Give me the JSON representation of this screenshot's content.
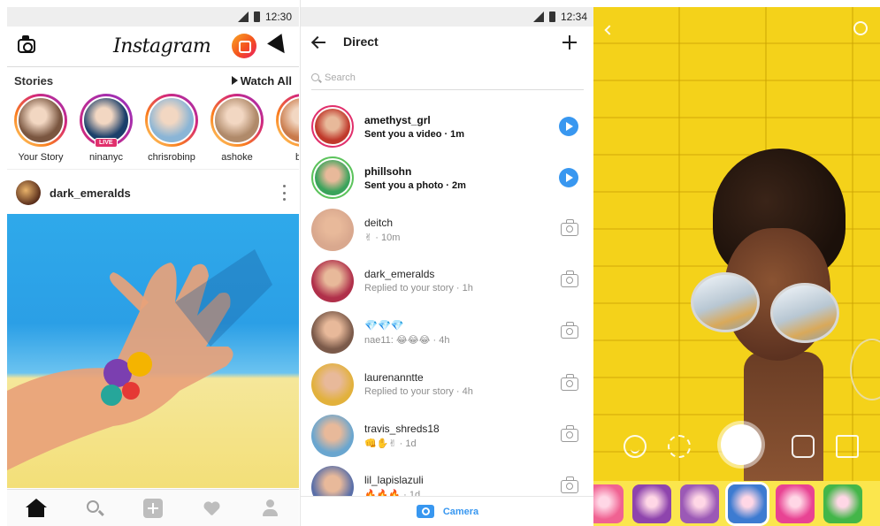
{
  "status_bars": {
    "left_time": "12:30",
    "middle_time": "12:34"
  },
  "feed": {
    "logo": "Instagram",
    "stories_label": "Stories",
    "watch_all_label": "Watch All",
    "stories": [
      {
        "name": "Your Story",
        "live": false,
        "color": "#7a5640"
      },
      {
        "name": "ninanyc",
        "live": true,
        "live_label": "LIVE",
        "color": "#1b3f6a"
      },
      {
        "name": "chrisrobinp",
        "live": false,
        "color": "#8ab5d6"
      },
      {
        "name": "ashoke",
        "live": false,
        "color": "#b08a6a"
      },
      {
        "name": "ber",
        "live": false,
        "color": "#c97a4a"
      }
    ],
    "post": {
      "username": "dark_emeralds"
    },
    "nav": [
      "home-icon",
      "search-icon",
      "add-icon",
      "heart-icon",
      "profile-icon"
    ]
  },
  "direct": {
    "title": "Direct",
    "search_placeholder": "Search",
    "threads": [
      {
        "name": "amethyst_grl",
        "message": "Sent you a video · 1m",
        "unread": true,
        "action": "play",
        "color": "#c0392b"
      },
      {
        "name": "phillsohn",
        "message": "Sent you a photo · 2m",
        "unread": true,
        "action": "play",
        "color": "#3aa35b"
      },
      {
        "name": "deitch",
        "message": "✌ · 10m",
        "unread": false,
        "action": "camera",
        "color": "#d9a88e"
      },
      {
        "name": "dark_emeralds",
        "message": "Replied to your story · 1h",
        "unread": false,
        "action": "camera",
        "color": "#b0304a"
      },
      {
        "name": "💎💎💎",
        "message": "nae11: 😂😂😂 · 4h",
        "unread": false,
        "action": "camera",
        "color": "#7b5a4a"
      },
      {
        "name": "laurenanntte",
        "message": "Replied to your story · 4h",
        "unread": false,
        "action": "camera",
        "color": "#e2b13c"
      },
      {
        "name": "travis_shreds18",
        "message": "👊✋✌ · 1d",
        "unread": false,
        "action": "camera",
        "color": "#6aa6cf"
      },
      {
        "name": "lil_lapislazuli",
        "message": "🔥🔥🔥 · 1d",
        "unread": false,
        "action": "camera",
        "color": "#5a6fa8"
      }
    ],
    "camera_label": "Camera"
  },
  "camera": {
    "filters": [
      {
        "name": "pink-face-filter",
        "color": "#f06292"
      },
      {
        "name": "purple-balloon-filter",
        "color": "#8e44ad"
      },
      {
        "name": "puppy-filter",
        "color": "#9b59b6"
      },
      {
        "name": "sunglasses-filter",
        "color": "#3d7bd1"
      },
      {
        "name": "sparkle-filter",
        "color": "#e84393"
      },
      {
        "name": "lips-filter",
        "color": "#43b649"
      }
    ]
  }
}
